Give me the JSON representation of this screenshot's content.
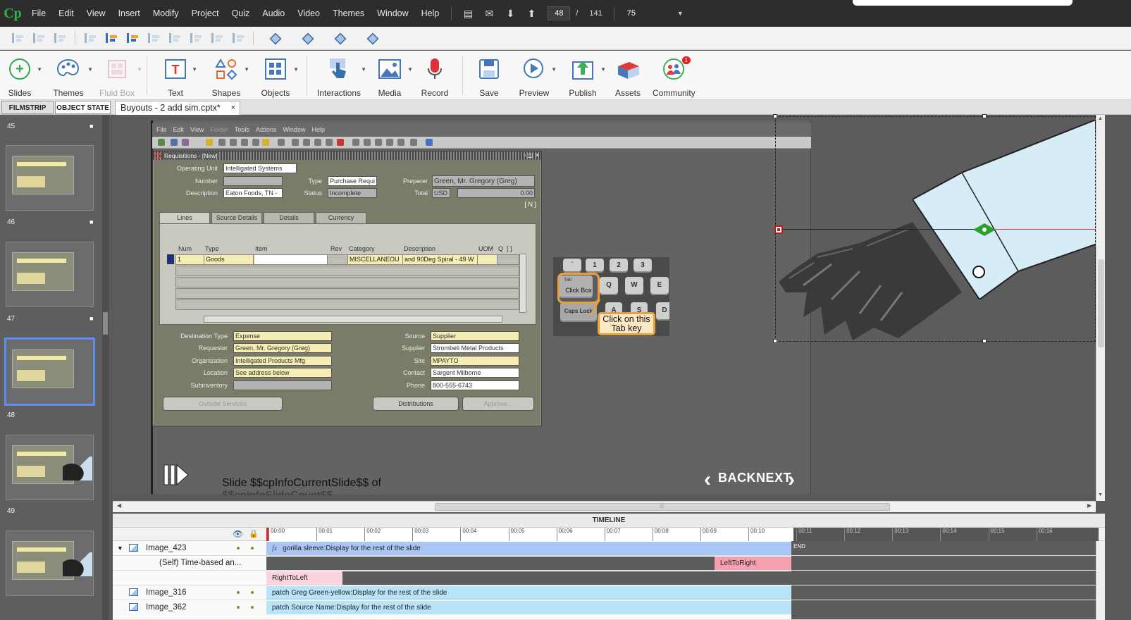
{
  "app": {
    "logo": "Cp",
    "menu": [
      "File",
      "Edit",
      "View",
      "Insert",
      "Modify",
      "Project",
      "Quiz",
      "Audio",
      "Video",
      "Themes",
      "Window",
      "Help"
    ],
    "current_slide": "48",
    "slide_sep": "/",
    "total_slides": "141",
    "zoom": "75"
  },
  "toolbar": {
    "slides": "Slides",
    "themes": "Themes",
    "fluid_box": "Fluid Box",
    "text": "Text",
    "shapes": "Shapes",
    "objects": "Objects",
    "interactions": "Interactions",
    "media": "Media",
    "record": "Record",
    "save": "Save",
    "preview": "Preview",
    "publish": "Publish",
    "assets": "Assets",
    "community": "Community",
    "community_badge": "1"
  },
  "tabs": {
    "filmstrip": "FILMSTRIP",
    "object_state": "OBJECT STATE",
    "document": "Buyouts - 2 add sim.cptx*",
    "close": "×"
  },
  "filmstrip": {
    "numbers": [
      "45",
      "46",
      "47",
      "48",
      "49"
    ],
    "selected": "48"
  },
  "oracle": {
    "menu": [
      "File",
      "Edit",
      "View",
      "Folder",
      "Tools",
      "Actions",
      "Window",
      "Help"
    ],
    "window_title": "Requisitions - [New]",
    "labels": {
      "operating_unit": "Operating Unit",
      "number": "Number",
      "description": "Description",
      "type": "Type",
      "status": "Status",
      "preparer": "Preparer",
      "total": "Total"
    },
    "values": {
      "operating_unit": "Intelligated Systems",
      "description": "Eaton Foods, TN -",
      "type": "Purchase Requi",
      "status": "Incomplete",
      "preparer": "Green, Mr. Gregory (Greg)",
      "currency": "USD",
      "total": "0.00",
      "bracket": "[ N ]"
    },
    "tabs": [
      "Lines",
      "Source Details",
      "Details",
      "Currency"
    ],
    "grid_headers": [
      "Num",
      "Type",
      "Item",
      "Rev",
      "Category",
      "Description",
      "UOM",
      "Q",
      "[ ]"
    ],
    "grid_row": {
      "num": "1",
      "type": "Goods",
      "category": "MISCELLANEOU",
      "description": "and 90Deg Spiral - 49 W"
    },
    "detail_labels": {
      "destination_type": "Destination Type",
      "requester": "Requester",
      "organization": "Organization",
      "location": "Location",
      "subinventory": "Subinventory",
      "source": "Source",
      "supplier": "Supplier",
      "site": "Site",
      "contact": "Contact",
      "phone": "Phone"
    },
    "detail_values": {
      "destination_type": "Expense",
      "requester": "Green, Mr. Gregory (Greg)",
      "organization": "Intelligated Products Mfg",
      "location": "See address below",
      "source": "Supplier",
      "supplier": "Strombeli Metal Products",
      "site": "MPAYTO",
      "contact": "Sargent Milborne",
      "phone": "800-555-6743"
    },
    "buttons": {
      "outside_services": "Outside Services",
      "distributions": "Distributions",
      "approve": "Approve..."
    }
  },
  "keyboard": {
    "keys": [
      "`",
      "1",
      "2",
      "3",
      "Q",
      "W",
      "E",
      "Caps Lock",
      "A",
      "S",
      "D"
    ],
    "tab_key": "Tab"
  },
  "click_box": "Click Box",
  "caption": {
    "line1": "Click on this",
    "line2": "Tab key"
  },
  "slide": {
    "counter_text": "Slide $$cpInfoCurrentSlide$$ of",
    "counter_text2": "$$cpInfoSlideCount$$",
    "back": "BACK",
    "next": "NEXT"
  },
  "timeline": {
    "title": "TIMELINE",
    "ticks": [
      "00:00",
      "00:01",
      "00:02",
      "00:03",
      "00:04",
      "00:05",
      "00:06",
      "00:07",
      "00:08",
      "00:09",
      "00:10",
      "00:11",
      "00:12",
      "00:13",
      "00:14",
      "00:15",
      "00:16"
    ],
    "end": "END",
    "rows": [
      {
        "name": "Image_423",
        "bar": "gorilla sleeve:Display for the rest of the slide"
      },
      {
        "name": "(Self) Time-based an...",
        "bar": "LeftToRight"
      },
      {
        "name": "",
        "bar": "RightToLeft"
      },
      {
        "name": "Image_316",
        "bar": "patch Greg Green-yellow:Display for the rest of the slide"
      },
      {
        "name": "Image_362",
        "bar": "patch Source Name:Display for the rest of the slide"
      }
    ],
    "fx": "fx"
  },
  "colors": {
    "accent": "#5b8ef0",
    "timeline_blue": "#a9c6f5",
    "timeline_cyan": "#b8e4f7",
    "timeline_pink": "#f4a0b0",
    "caption_border": "#e8a040"
  }
}
